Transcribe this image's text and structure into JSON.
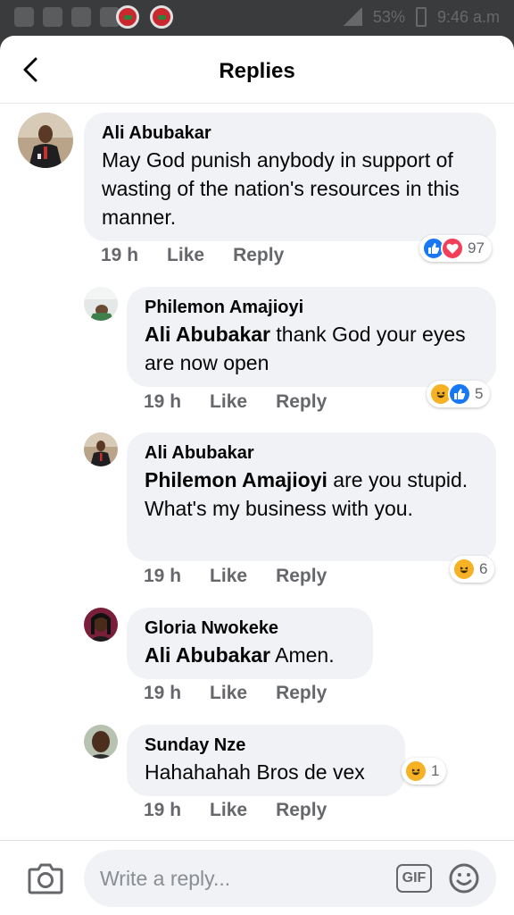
{
  "header": {
    "title": "Replies"
  },
  "statusbar": {
    "battery": "53%",
    "time": "9:46 a.m"
  },
  "comments": [
    {
      "author": "Ali Abubakar",
      "text": "May God punish anybody in support of wasting of the nation's resources in this manner.",
      "time": "19 h",
      "like": "Like",
      "reply": "Reply",
      "reaction_count": "97",
      "reactions": [
        "like",
        "love"
      ]
    },
    {
      "author": "Philemon Amajioyi",
      "mention": "Ali Abubakar",
      "text": " thank God your eyes are now open",
      "time": "19 h",
      "like": "Like",
      "reply": "Reply",
      "reaction_count": "5",
      "reactions": [
        "haha",
        "like"
      ]
    },
    {
      "author": "Ali Abubakar",
      "mention": "Philemon Amajioyi",
      "text": " are you stupid. What's my business with you.",
      "time": "19 h",
      "like": "Like",
      "reply": "Reply",
      "reaction_count": "6",
      "reactions": [
        "haha"
      ]
    },
    {
      "author": "Gloria Nwokeke",
      "mention": "Ali Abubakar",
      "text": " Amen.",
      "time": "19 h",
      "like": "Like",
      "reply": "Reply"
    },
    {
      "author": "Sunday Nze",
      "text": "Hahahahah Bros de vex",
      "time": "19 h",
      "like": "Like",
      "reply": "Reply",
      "reaction_count": "1",
      "reactions": [
        "haha"
      ]
    }
  ],
  "composer": {
    "placeholder": "Write a reply...",
    "gif_label": "GIF"
  },
  "colors": {
    "like": "#1877f2",
    "love": "#f33e58",
    "haha": "#f7b125",
    "bubble": "#f0f2f5",
    "meta": "#65676b"
  }
}
